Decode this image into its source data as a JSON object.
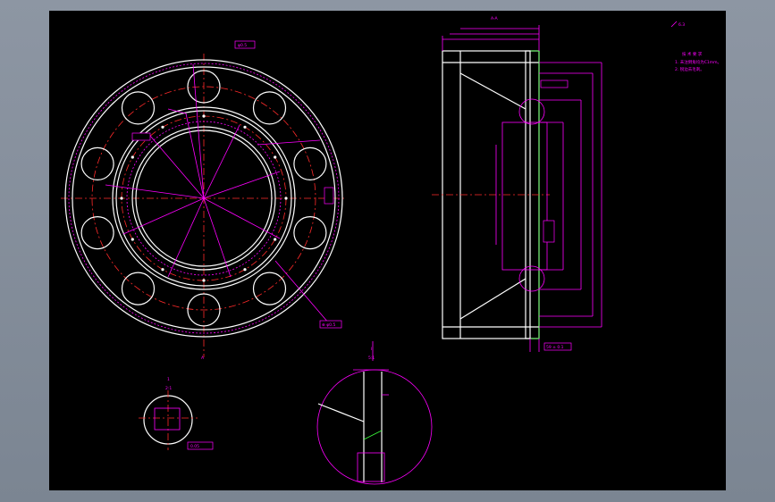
{
  "app": {
    "background": "#86909d",
    "canvas": "#000000"
  },
  "colors": {
    "dimension": "#ff00ff",
    "outline": "#ffffff",
    "centerline": "#ff2a2a",
    "hatch": "#3cff3c"
  },
  "labels": {
    "section_mark_top": "A-A",
    "section_mark_bottom": "A",
    "roughness_symbol": "6.3",
    "tech_req_title": "技 术 要 求",
    "tech_req_1": "1. 未注倒角均为C1mm。",
    "tech_req_2": "2. 锐边去毛刺。",
    "dim_phi_a": "φ0.5",
    "dim_position": "⊕ φ0.5",
    "dim_box_1": "0.05",
    "dim_box_2": "0.08",
    "dim_box_3": "0.3",
    "dim_width": "59 ± 0.1",
    "detail_mark_1": "1",
    "detail_scale_1": "2:1",
    "detail_mark_2": "I",
    "detail_scale_2": "5:1"
  }
}
